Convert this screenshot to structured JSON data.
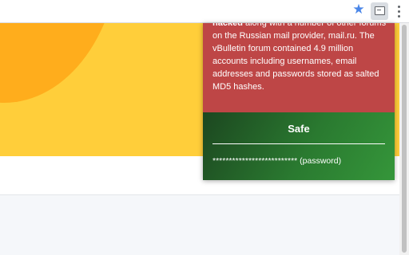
{
  "toolbar": {
    "bookmark_icon": "star-icon",
    "extension_icon": "screen-icon",
    "menu_icon": "vertical-dots-icon"
  },
  "colors": {
    "breach_bg": "#be4646",
    "safe_bg": "#2a7a30",
    "page_yellow": "#ffce3a",
    "page_orange": "#ffad1c"
  },
  "popup": {
    "breach": {
      "lead_bold": "hacked",
      "description": " along with a number of other forums on the Russian mail provider, mail.ru. The vBulletin forum contained 4.9 million accounts including usernames, email addresses and passwords stored as salted MD5 hashes."
    },
    "status": {
      "title": "Safe",
      "masked_password": "**************************",
      "field_label": "(password)"
    }
  }
}
